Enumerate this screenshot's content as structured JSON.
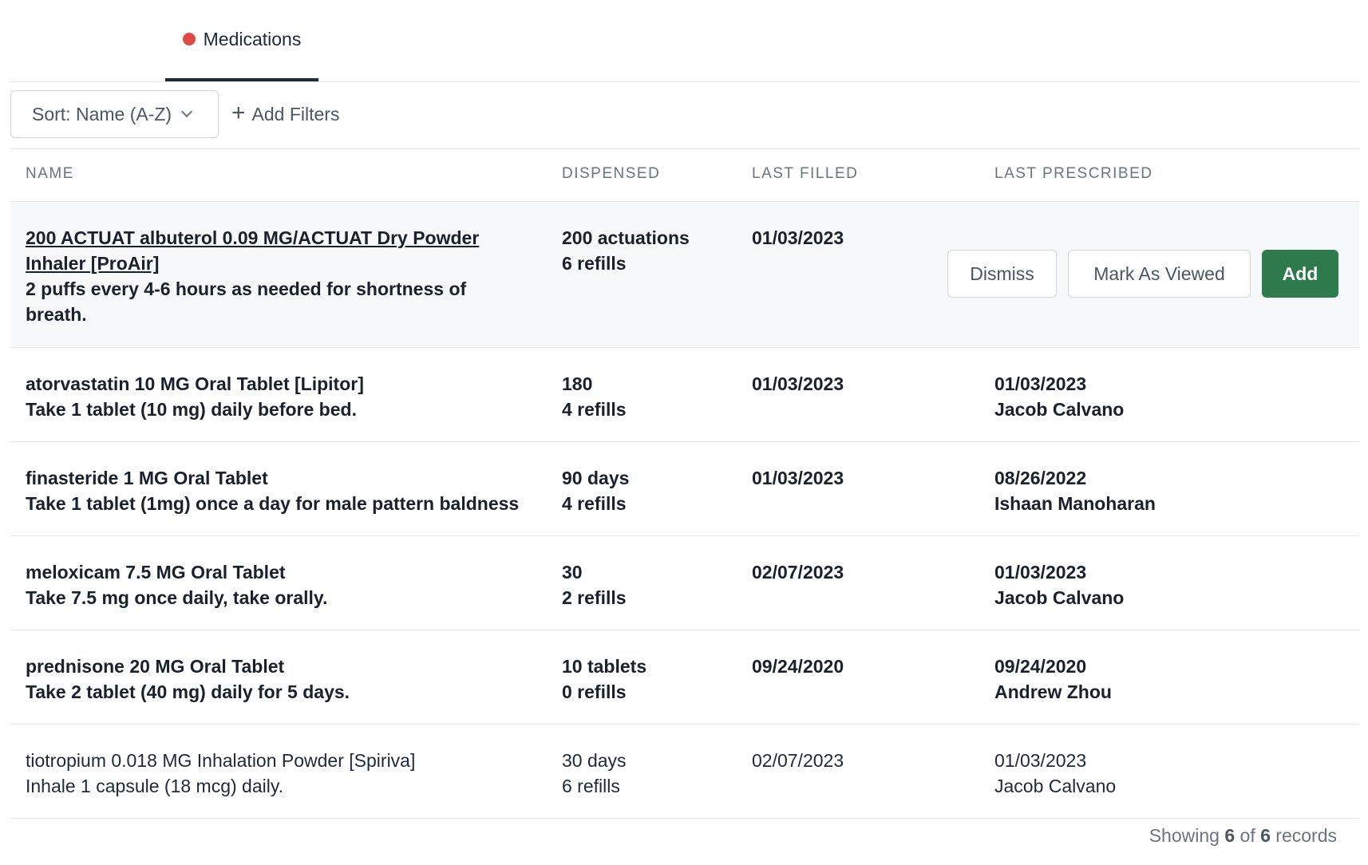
{
  "tabs": [
    {
      "label": "Medications",
      "status_color": "#dc4a44",
      "active": true
    }
  ],
  "toolbar": {
    "sort_label": "Sort: Name (A-Z)",
    "add_filters_label": "Add Filters"
  },
  "table": {
    "columns": [
      "NAME",
      "DISPENSED",
      "LAST FILLED",
      "LAST PRESCRIBED"
    ],
    "rows": [
      {
        "name": "200 ACTUAT albuterol 0.09 MG/ACTUAT Dry Powder Inhaler [ProAir]",
        "instructions": "2 puffs every 4-6 hours as needed for shortness of breath.",
        "dispensed": "200 actuations",
        "refills": "6 refills",
        "last_filled": "01/03/2023",
        "last_prescribed_date": "",
        "prescriber": "",
        "actions": {
          "dismiss": "Dismiss",
          "mark_viewed": "Mark As Viewed",
          "add": "Add"
        }
      },
      {
        "name": "atorvastatin 10 MG Oral Tablet [Lipitor]",
        "instructions": "Take 1 tablet (10 mg) daily before bed.",
        "dispensed": "180",
        "refills": "4 refills",
        "last_filled": "01/03/2023",
        "last_prescribed_date": "01/03/2023",
        "prescriber": "Jacob Calvano"
      },
      {
        "name": "finasteride 1 MG Oral Tablet",
        "instructions": "Take 1 tablet (1mg) once a day for male pattern baldness",
        "dispensed": "90 days",
        "refills": "4 refills",
        "last_filled": "01/03/2023",
        "last_prescribed_date": "08/26/2022",
        "prescriber": "Ishaan Manoharan"
      },
      {
        "name": "meloxicam 7.5 MG Oral Tablet",
        "instructions": "Take 7.5 mg once daily, take orally.",
        "dispensed": "30",
        "refills": "2 refills",
        "last_filled": "02/07/2023",
        "last_prescribed_date": "01/03/2023",
        "prescriber": "Jacob Calvano"
      },
      {
        "name": "prednisone 20 MG Oral Tablet",
        "instructions": "Take 2 tablet (40 mg) daily for 5 days.",
        "dispensed": "10 tablets",
        "refills": "0 refills",
        "last_filled": "09/24/2020",
        "last_prescribed_date": "09/24/2020",
        "prescriber": "Andrew Zhou"
      },
      {
        "name": "tiotropium 0.018 MG Inhalation Powder [Spiriva]",
        "instructions": "Inhale 1 capsule (18 mcg) daily.",
        "dispensed": "30 days",
        "refills": "6 refills",
        "last_filled": "02/07/2023",
        "last_prescribed_date": "01/03/2023",
        "prescriber": "Jacob Calvano"
      }
    ]
  },
  "footer": {
    "prefix": "Showing",
    "shown": "6",
    "of": "of",
    "total": "6",
    "suffix": "records"
  },
  "colors": {
    "accent_green": "#2f7a4d",
    "status_red": "#dc4a44"
  }
}
